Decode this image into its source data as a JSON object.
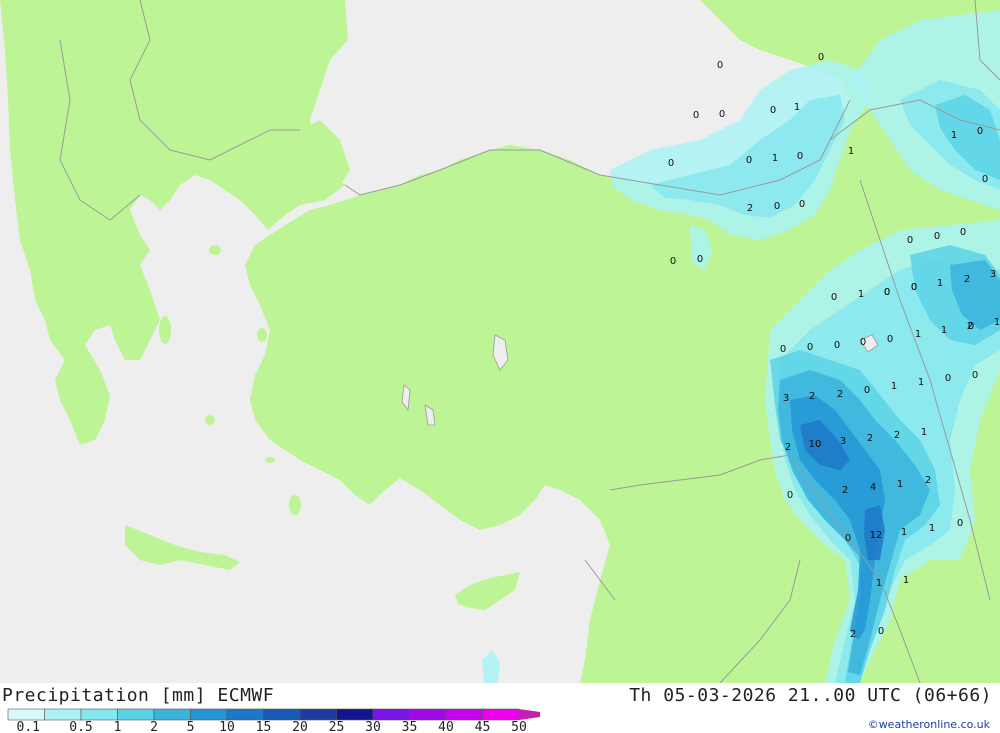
{
  "title": "Precipitation [mm] ECMWF",
  "valid_time": "Th 05-03-2026 21..00 UTC (06+66)",
  "credit": "©weatheronline.co.uk",
  "colors": {
    "sea": "#eeeeee",
    "land": "#bdf596",
    "border": "#9a9a9a",
    "scale": [
      "#d6fafa",
      "#aaf2f5",
      "#86e6ee",
      "#5cd2e6",
      "#3bb4dc",
      "#2496d6",
      "#1e78c8",
      "#1a5ab4",
      "#1e3ca0",
      "#14148c",
      "#7814e6",
      "#a00ae6",
      "#c800f0",
      "#f000f0",
      "#c81eb4"
    ]
  },
  "legend": {
    "labels": [
      "0.1",
      "0.5",
      "1",
      "2",
      "5",
      "10",
      "15",
      "20",
      "25",
      "30",
      "35",
      "40",
      "45",
      "50"
    ]
  },
  "map_values": [
    "0",
    "0",
    "0",
    "0",
    "0",
    "1",
    "0",
    "1",
    "0",
    "1",
    "0",
    "0",
    "1",
    "0",
    "2",
    "0",
    "0",
    "0",
    "0",
    "0",
    "0",
    "0",
    "0",
    "0",
    "0",
    "1",
    "0",
    "0",
    "1",
    "2",
    "3",
    "0",
    "1",
    "1",
    "2",
    "1",
    "0",
    "0",
    "0",
    "0",
    "0",
    "1",
    "0",
    "1",
    "0",
    "0",
    "3",
    "2",
    "2",
    "2",
    "10",
    "3",
    "2",
    "2",
    "1",
    "0",
    "2",
    "4",
    "1",
    "2",
    "0",
    "0",
    "12",
    "1",
    "1",
    "1",
    "1",
    "2",
    "0"
  ]
}
